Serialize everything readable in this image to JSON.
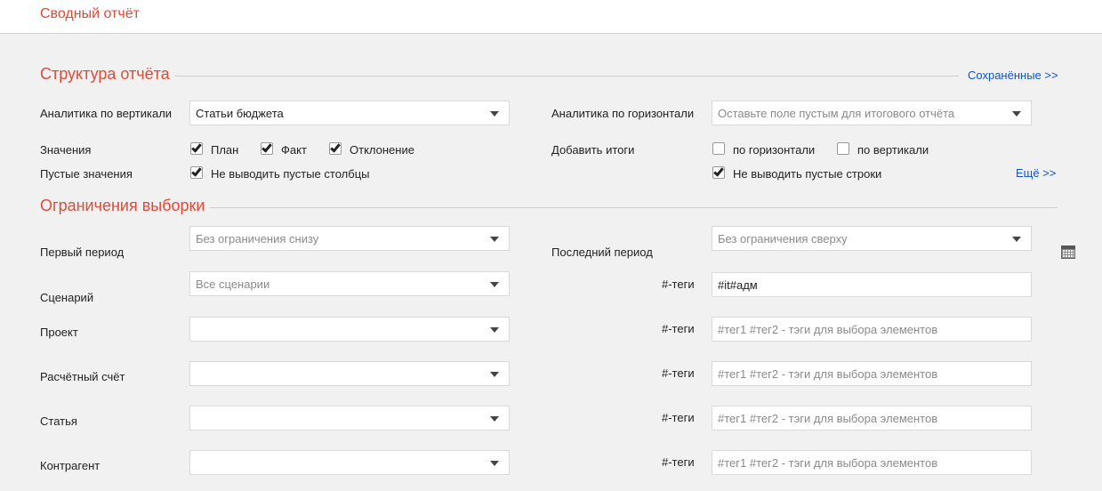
{
  "header": {
    "title": "Сводный отчёт"
  },
  "structure": {
    "title": "Структура отчёта",
    "saved_link": "Сохранённые >>",
    "vertical_label": "Аналитика по вертикали",
    "vertical_value": "Статьи бюджета",
    "horizontal_label": "Аналитика по горизонтали",
    "horizontal_placeholder": "Оставьте поле пустым для итогового отчёта",
    "values_label": "Значения",
    "values": [
      {
        "label": "План",
        "checked": true
      },
      {
        "label": "Факт",
        "checked": true
      },
      {
        "label": "Отклонение",
        "checked": true
      }
    ],
    "totals_label": "Добавить итоги",
    "totals": [
      {
        "label": "по горизонтали",
        "checked": false
      },
      {
        "label": "по вертикали",
        "checked": false
      }
    ],
    "empty_label": "Пустые значения",
    "hide_empty_columns": {
      "label": "Не выводить пустые столбцы",
      "checked": true
    },
    "hide_empty_rows": {
      "label": "Не выводить пустые строки",
      "checked": true
    },
    "more_link": "Ещё >>"
  },
  "filters": {
    "title": "Ограничения выборки",
    "first_period_label": "Первый период",
    "first_period_placeholder": "Без ограничения снизу",
    "last_period_label": "Последний период",
    "last_period_placeholder": "Без ограничения сверху",
    "scenario_label": "Сценарий",
    "scenario_placeholder": "Все сценарии",
    "tags_label": "#-теги",
    "tags_placeholder": "#тег1 #тег2 - тэги для выбора элементов",
    "scenario_tags_value": "#it#адм",
    "project_label": "Проект",
    "account_label": "Расчётный счёт",
    "article_label": "Статья",
    "counterparty_label": "Контрагент",
    "calendar_icon": "calendar-icon"
  }
}
